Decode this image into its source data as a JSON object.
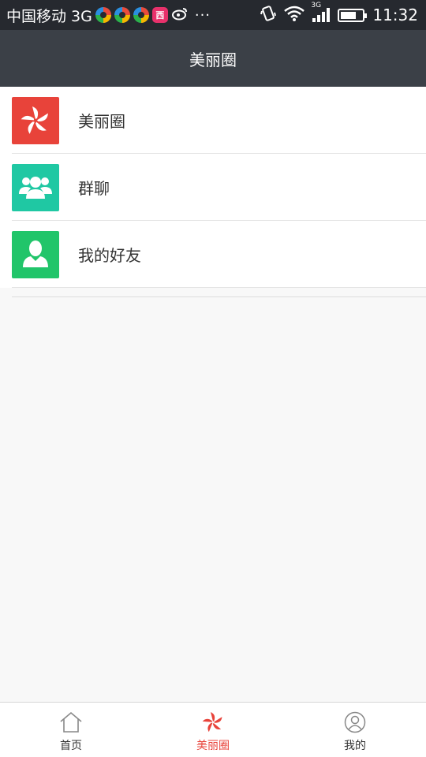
{
  "status_bar": {
    "carrier": "中国移动 3G",
    "more": "···",
    "network_type": "3G",
    "time": "11:32",
    "battery_level": 0.7,
    "icons": [
      "pinwheel-app-icon",
      "pinwheel-app-icon",
      "pinwheel-app-icon",
      "red-app-icon",
      "weibo-icon",
      "vibrate-icon",
      "wifi-icon",
      "signal-icon",
      "battery-icon"
    ]
  },
  "header": {
    "title": "美丽圈"
  },
  "menu": {
    "items": [
      {
        "label": "美丽圈",
        "icon": "pinwheel-icon",
        "icon_bg": "#e8433a"
      },
      {
        "label": "群聊",
        "icon": "group-icon",
        "icon_bg": "#1fc8a3"
      },
      {
        "label": "我的好友",
        "icon": "person-icon",
        "icon_bg": "#21c56a"
      }
    ]
  },
  "tab_bar": {
    "tabs": [
      {
        "label": "首页",
        "icon": "home-icon",
        "active": false
      },
      {
        "label": "美丽圈",
        "icon": "pinwheel-icon",
        "active": true
      },
      {
        "label": "我的",
        "icon": "profile-icon",
        "active": false
      }
    ],
    "active_color": "#e8433a"
  },
  "colors": {
    "status_bar_bg": "#26292f",
    "header_bg": "#3b4047",
    "page_bg": "#f8f8f8"
  }
}
